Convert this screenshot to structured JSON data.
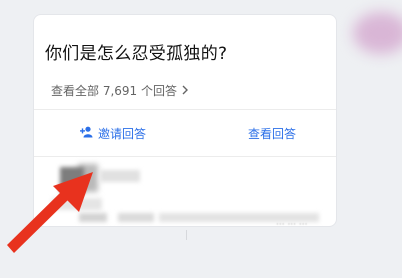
{
  "question": {
    "title": "你们是怎么忍受孤独的?",
    "view_all_label": "查看全部 7,691 个回答"
  },
  "actions": {
    "invite_label": "邀请回答",
    "view_label": "查看回答"
  },
  "icons": {
    "invite": "add-user-icon",
    "more": "chevron-right-icon",
    "annotation": "red-arrow-icon"
  },
  "colors": {
    "accent": "#2b6fe8",
    "annotation_arrow": "#e8321e"
  }
}
